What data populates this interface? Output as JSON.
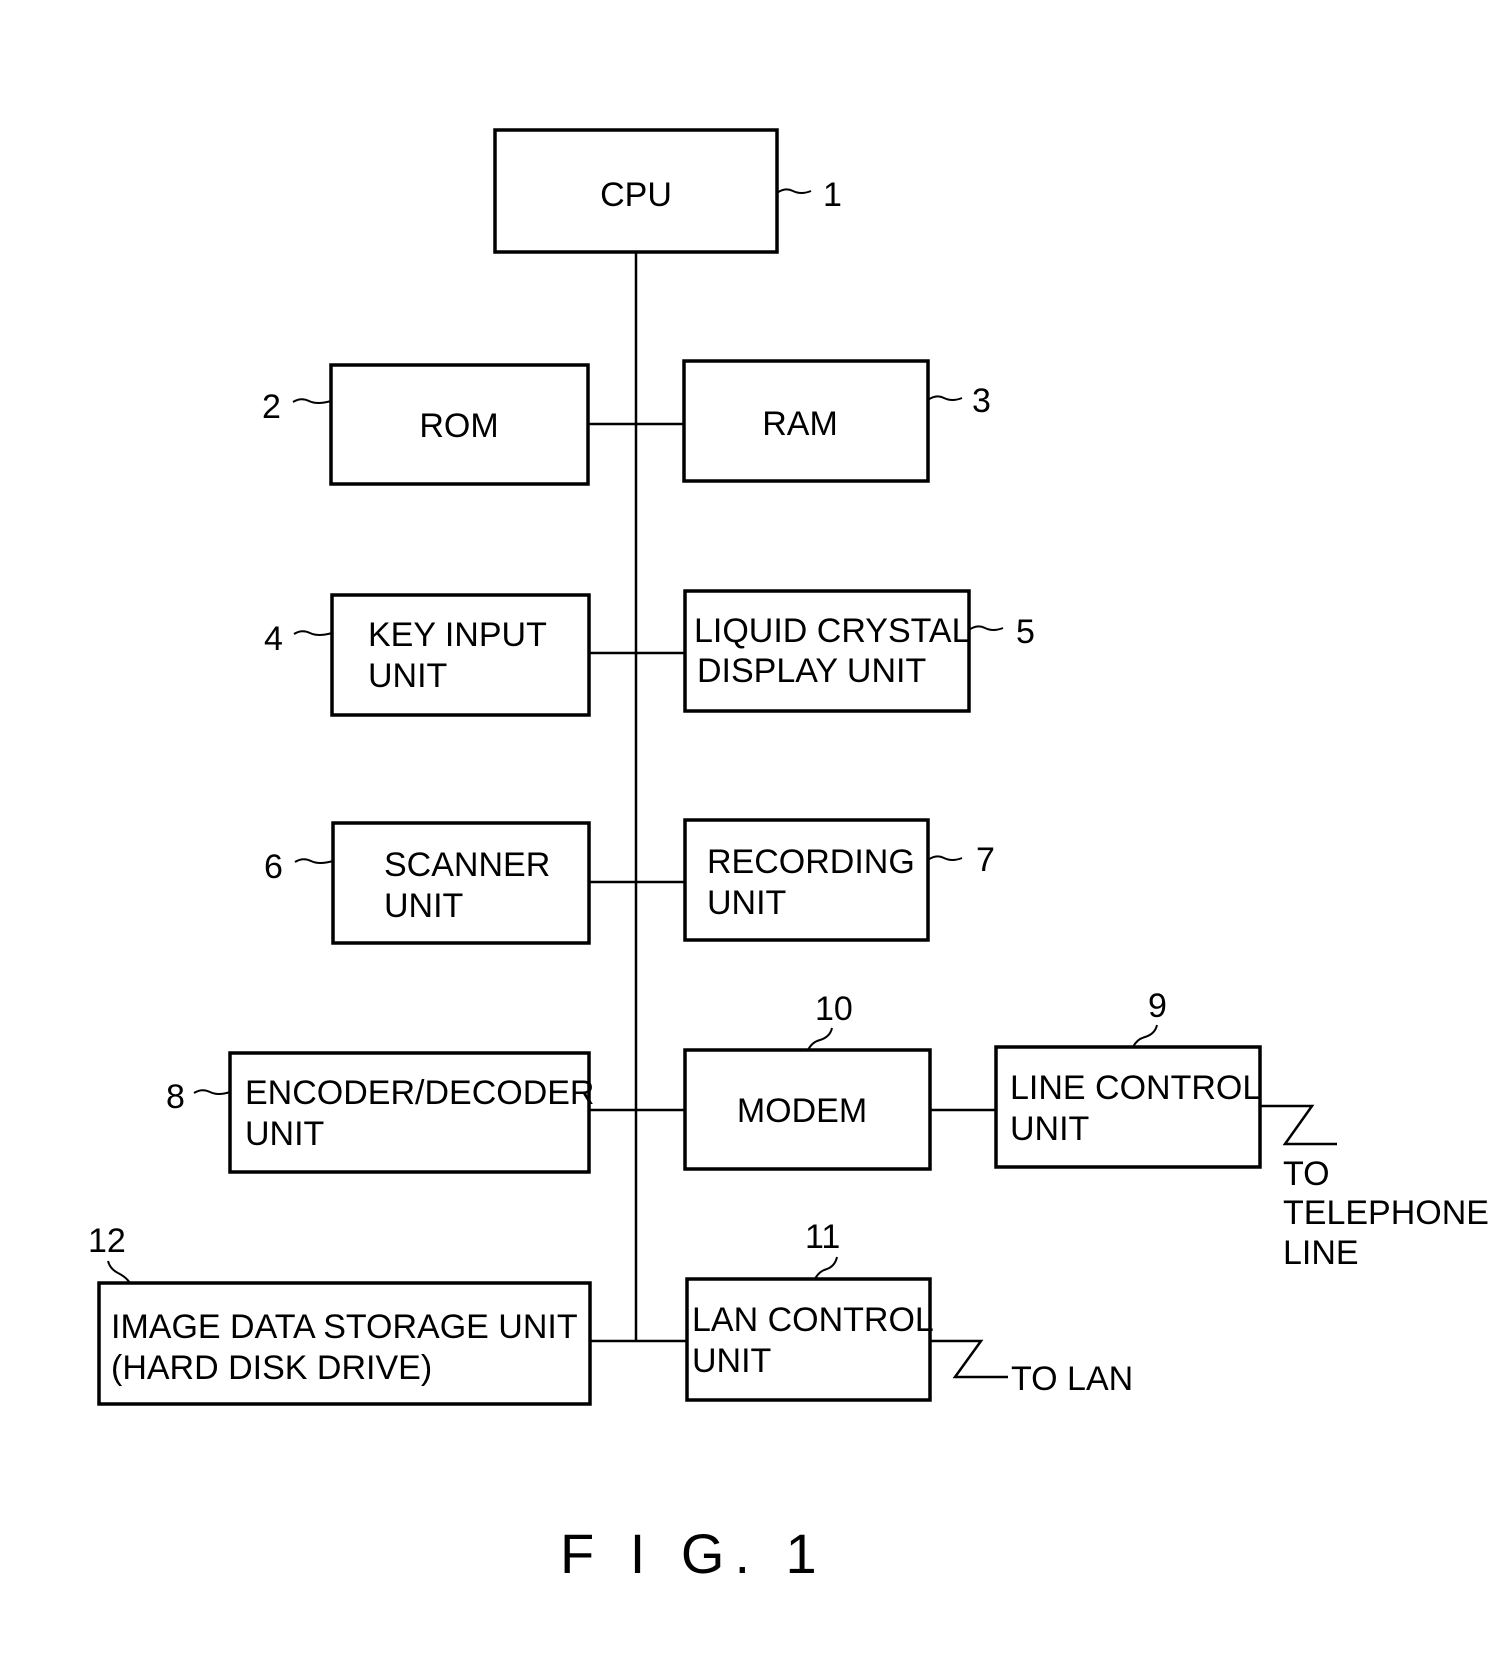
{
  "figure": {
    "caption": "F I G. 1",
    "blocks": [
      {
        "id": "cpu",
        "ref": "1",
        "lines": [
          "CPU"
        ]
      },
      {
        "id": "rom",
        "ref": "2",
        "lines": [
          "ROM"
        ]
      },
      {
        "id": "ram",
        "ref": "3",
        "lines": [
          "RAM"
        ]
      },
      {
        "id": "key-input",
        "ref": "4",
        "lines": [
          "KEY INPUT",
          "UNIT"
        ]
      },
      {
        "id": "lcd",
        "ref": "5",
        "lines": [
          "LIQUID CRYSTAL",
          "DISPLAY UNIT"
        ]
      },
      {
        "id": "scanner",
        "ref": "6",
        "lines": [
          "SCANNER",
          "UNIT"
        ]
      },
      {
        "id": "recording",
        "ref": "7",
        "lines": [
          "RECORDING",
          "UNIT"
        ]
      },
      {
        "id": "encoder",
        "ref": "8",
        "lines": [
          "ENCODER/DECODER",
          "UNIT"
        ]
      },
      {
        "id": "line-control",
        "ref": "9",
        "lines": [
          "LINE CONTROL",
          "UNIT"
        ]
      },
      {
        "id": "modem",
        "ref": "10",
        "lines": [
          "MODEM"
        ]
      },
      {
        "id": "lan-control",
        "ref": "11",
        "lines": [
          "LAN CONTROL",
          "UNIT"
        ]
      },
      {
        "id": "image-storage",
        "ref": "12",
        "lines": [
          "IMAGE DATA STORAGE UNIT",
          "(HARD DISK DRIVE)"
        ]
      }
    ],
    "external_labels": {
      "telephone": [
        "TO",
        "TELEPHONE",
        "LINE"
      ],
      "lan": "TO LAN"
    },
    "connections": [
      [
        "cpu",
        "bus"
      ],
      [
        "rom",
        "bus"
      ],
      [
        "ram",
        "bus"
      ],
      [
        "key-input",
        "bus"
      ],
      [
        "lcd",
        "bus"
      ],
      [
        "scanner",
        "bus"
      ],
      [
        "recording",
        "bus"
      ],
      [
        "encoder",
        "bus"
      ],
      [
        "modem",
        "bus"
      ],
      [
        "image-storage",
        "bus"
      ],
      [
        "lan-control",
        "bus"
      ],
      [
        "modem",
        "line-control"
      ],
      [
        "line-control",
        "telephone"
      ],
      [
        "lan-control",
        "lan"
      ]
    ]
  }
}
